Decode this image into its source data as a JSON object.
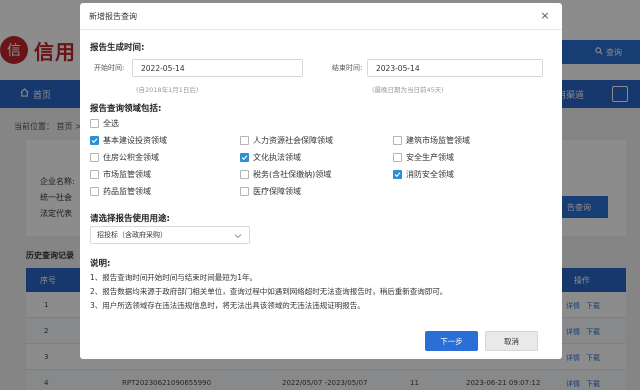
{
  "background": {
    "logo_mark": "信",
    "logo_text": "信用",
    "search_label": "查询",
    "nav_home": "首页",
    "nav_channel": "用渠道",
    "breadcrumb_prefix": "当前位置：",
    "breadcrumb_home": "首页",
    "breadcrumb_sep": ">",
    "company_name_label": "企业名称:",
    "credit_code_label": "统一社会",
    "legal_rep_label": "法定代表",
    "report_query_button": "告查询",
    "history_title": "历史查询记录",
    "table_headers": [
      "序号",
      "操作"
    ],
    "rows": [
      {
        "index": "1",
        "actions": [
          "详情",
          "下载"
        ]
      },
      {
        "index": "2",
        "actions": [
          "详情",
          "下载"
        ]
      },
      {
        "index": "3",
        "actions": [
          "详情",
          "下载"
        ]
      },
      {
        "index": "4",
        "report_no": "RPT20230621090655990",
        "period": "2022/05/07 -2023/05/07",
        "count": "11",
        "time": "2023-06-21 09:07:12",
        "actions": [
          "详情",
          "下载"
        ]
      }
    ]
  },
  "dialog": {
    "title": "新增报告查询",
    "close_symbol": "×",
    "time_section_title": "报告生成时间:",
    "start_label": "开始时间:",
    "start_value": "2022-05-14",
    "start_hint": "(自2018年1月1日后)",
    "end_label": "结束时间:",
    "end_value": "2023-05-14",
    "end_hint": "(最晚日期为当日前45天)",
    "domain_section_title": "报告查询领域包括:",
    "select_all_label": "全选",
    "domains": [
      {
        "label": "基本建设投资领域",
        "checked": true
      },
      {
        "label": "人力资源社会保障领域",
        "checked": false
      },
      {
        "label": "建筑市场监管领域",
        "checked": false
      },
      {
        "label": "住房公积金领域",
        "checked": false
      },
      {
        "label": "文化执法领域",
        "checked": true
      },
      {
        "label": "安全生产领域",
        "checked": false
      },
      {
        "label": "市场监管领域",
        "checked": false
      },
      {
        "label": "税务(含社保缴纳)领域",
        "checked": false
      },
      {
        "label": "消防安全领域",
        "checked": true
      },
      {
        "label": "药品监管领域",
        "checked": false
      },
      {
        "label": "医疗保障领域",
        "checked": false
      }
    ],
    "purpose_section_title": "请选择报告使用用途:",
    "purpose_value": "招投标（含政府采购）",
    "notes_title": "说明:",
    "notes": [
      "1、报告查询时间开始时间与结束时间最短为1年。",
      "2、报告数据均来源于政府部门相关单位，查询过程中如遇到网络超时无法查询报告时，稍后重新查询即可。",
      "3、用户所选领域存在违法违规信息时，将无法出具该领域的无违法违规证明报告。"
    ],
    "next_button": "下一步",
    "cancel_button": "取消"
  },
  "colors": {
    "primary": "#2b6fd6",
    "brand_red": "#c0262d",
    "checkbox_checked": "#2b8fd6"
  }
}
